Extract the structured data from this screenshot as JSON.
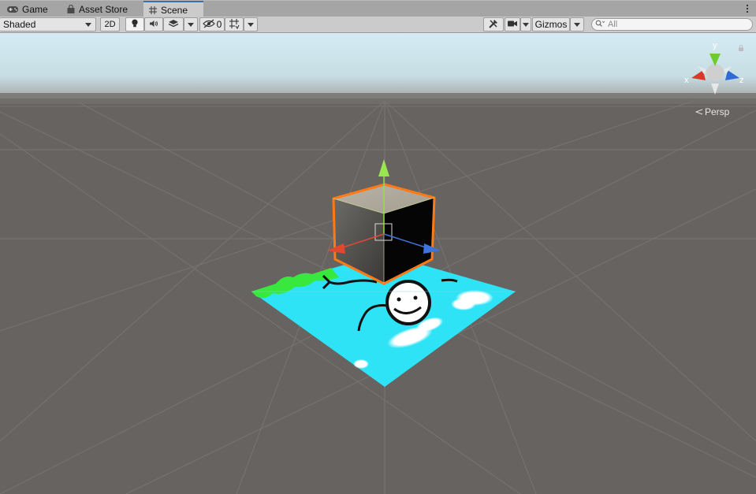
{
  "tabs": [
    {
      "label": "Game",
      "icon": "gamepad-icon"
    },
    {
      "label": "Asset Store",
      "icon": "shopping-bag-icon"
    },
    {
      "label": "Scene",
      "icon": "grid-hash-icon",
      "active": true
    }
  ],
  "toolbar": {
    "draw_mode": "Shaded",
    "mode_2d": "2D",
    "hidden_count": "0",
    "gizmos_label": "Gizmos",
    "search_placeholder": "All"
  },
  "scene": {
    "projection_label": "Persp",
    "axis_labels": {
      "x": "x",
      "y": "y",
      "z": "z"
    },
    "colors": {
      "sky": "#c9e4ef",
      "ground": "#676361",
      "quad": "#2ee3f5",
      "selection_outline": "#ff7a14",
      "axis_x": "#e0412a",
      "axis_y": "#7ed321",
      "axis_z": "#3b73d9"
    }
  }
}
